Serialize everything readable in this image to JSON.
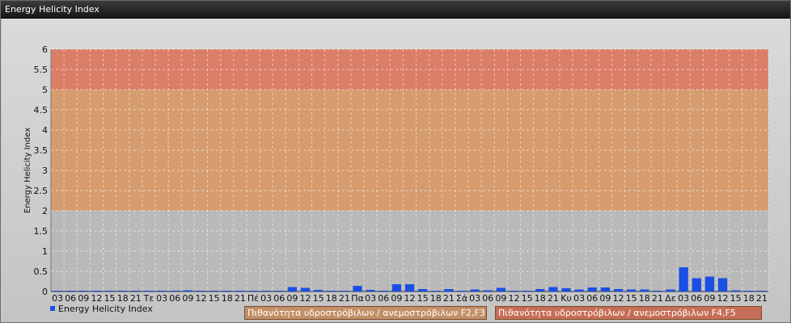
{
  "window": {
    "title": "Energy Helicity Index"
  },
  "chart_data": {
    "type": "bar",
    "title": "Energy Helicity Index",
    "ylabel": "Energy Helicity Index",
    "xlabel": "",
    "ylim": [
      0,
      6
    ],
    "yticks": [
      "0",
      "0.5",
      "1",
      "1.5",
      "2",
      "2.5",
      "3",
      "3.5",
      "4",
      "4.5",
      "5",
      "5.5",
      "6"
    ],
    "grid": true,
    "categories": [
      "03",
      "06",
      "09",
      "12",
      "15",
      "18",
      "21",
      "Τε",
      "03",
      "06",
      "09",
      "12",
      "15",
      "18",
      "21",
      "Πέ",
      "03",
      "06",
      "09",
      "12",
      "15",
      "18",
      "21",
      "Πα",
      "03",
      "06",
      "09",
      "12",
      "15",
      "18",
      "21",
      "Σά",
      "03",
      "06",
      "09",
      "12",
      "15",
      "18",
      "21",
      "Κυ",
      "03",
      "06",
      "09",
      "12",
      "15",
      "18",
      "21",
      "Δε",
      "03",
      "06",
      "09",
      "12",
      "15",
      "18",
      "21"
    ],
    "series": [
      {
        "name": "Energy Helicity Index",
        "color": "#1a4fe6",
        "values": [
          0.02,
          0.02,
          0.02,
          0.02,
          0.02,
          0.02,
          0.02,
          0.02,
          0.02,
          0.02,
          0.03,
          0.02,
          0.02,
          0.02,
          0.02,
          0.02,
          0.02,
          0.02,
          0.11,
          0.09,
          0.04,
          0.02,
          0.02,
          0.14,
          0.04,
          0.02,
          0.18,
          0.18,
          0.06,
          0.02,
          0.06,
          0.02,
          0.05,
          0.03,
          0.09,
          0.02,
          0.02,
          0.06,
          0.11,
          0.08,
          0.05,
          0.1,
          0.1,
          0.06,
          0.05,
          0.05,
          0.02,
          0.05,
          0.6,
          0.33,
          0.37,
          0.33,
          0.03,
          0.02,
          0.02
        ]
      }
    ],
    "bands": [
      {
        "from": 0,
        "to": 2,
        "color": "#b9b9b9"
      },
      {
        "from": 2,
        "to": 5,
        "label": "Πιθανότητα υδροστρόβιλων / ανεμοστρόβιλων F2,F3",
        "color": "#d69c6e"
      },
      {
        "from": 5,
        "to": 6,
        "label": "Πιθανότητα υδροστρόβιλων / ανεμοστρόβιλων F4,F5",
        "color": "#db7e67"
      }
    ],
    "legend_position": "bottom-left"
  }
}
